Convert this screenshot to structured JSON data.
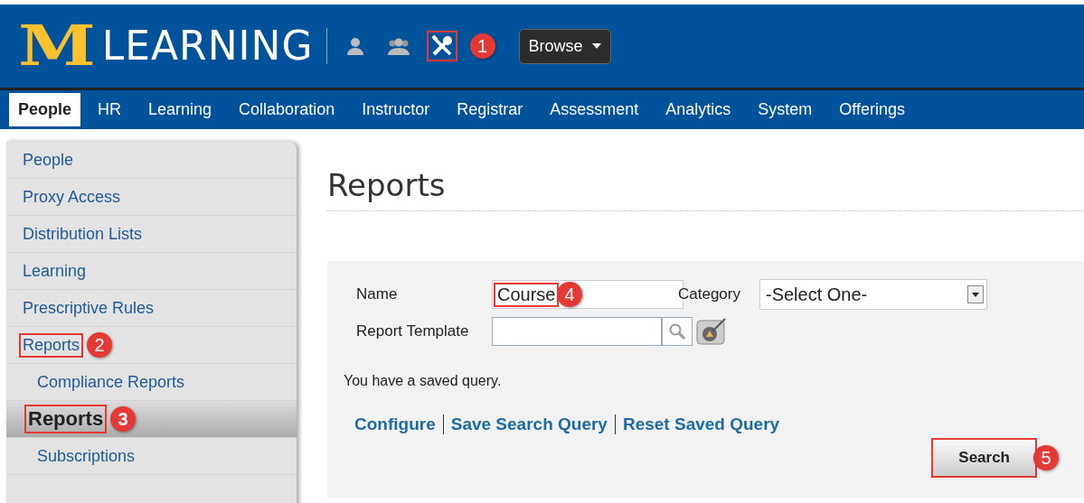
{
  "header": {
    "logo_letter": "M",
    "logo_text": "LEARNING",
    "tools": [
      {
        "kind": "person",
        "highlighted": false
      },
      {
        "kind": "group",
        "highlighted": false
      },
      {
        "kind": "tools",
        "highlighted": true,
        "callout": "1"
      }
    ],
    "browse": "Browse"
  },
  "nav_tabs": [
    {
      "label": "People",
      "selected": true
    },
    {
      "label": "HR",
      "selected": false
    },
    {
      "label": "Learning",
      "selected": false
    },
    {
      "label": "Collaboration",
      "selected": false
    },
    {
      "label": "Instructor",
      "selected": false
    },
    {
      "label": "Registrar",
      "selected": false
    },
    {
      "label": "Assessment",
      "selected": false
    },
    {
      "label": "Analytics",
      "selected": false
    },
    {
      "label": "System",
      "selected": false
    },
    {
      "label": "Offerings",
      "selected": false
    }
  ],
  "sidebar": {
    "items": [
      {
        "label": "People",
        "selected": false,
        "highlighted": false
      },
      {
        "label": "Proxy Access",
        "selected": false,
        "highlighted": false
      },
      {
        "label": "Distribution Lists",
        "selected": false,
        "highlighted": false
      },
      {
        "label": "Learning",
        "selected": false,
        "highlighted": false
      },
      {
        "label": "Prescriptive Rules",
        "selected": false,
        "highlighted": false
      },
      {
        "label": "Reports",
        "selected": false,
        "highlighted": true,
        "callout": "2",
        "children": [
          {
            "label": "Compliance Reports",
            "selected": false,
            "highlighted": false
          },
          {
            "label": "Reports",
            "selected": true,
            "highlighted": true,
            "callout": "3"
          },
          {
            "label": "Subscriptions",
            "selected": false,
            "highlighted": false
          }
        ]
      }
    ]
  },
  "page_title": "Reports",
  "form": {
    "name": {
      "label": "Name",
      "value": "Course",
      "highlighted": true,
      "callout": "4"
    },
    "category": {
      "label": "Category",
      "value": "-Select One-"
    },
    "template": {
      "label": "Report Template"
    },
    "message": "You have a saved query.",
    "links": [
      "Configure",
      "Save Search Query",
      "Reset Saved Query"
    ],
    "search_button": {
      "label": "Search",
      "highlighted": true,
      "callout": "5"
    }
  }
}
